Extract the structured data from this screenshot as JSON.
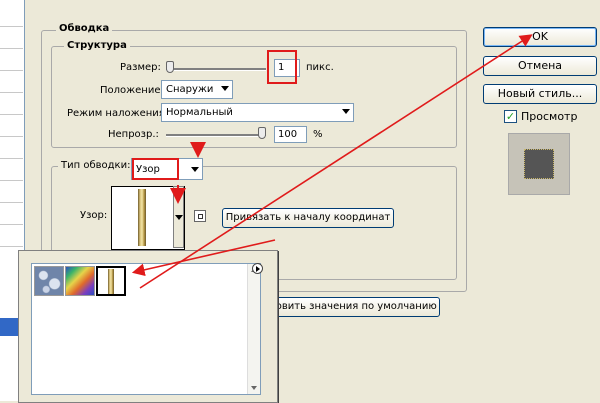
{
  "stroke": {
    "section_title": "Обводка",
    "structure_title": "Структура",
    "size_label": "Размер:",
    "size_value": "1",
    "size_unit": "пикс.",
    "position_label": "Положение:",
    "position_value": "Снаружи",
    "blend_label": "Режим наложения:",
    "blend_value": "Нормальный",
    "opacity_label": "Непрозр.:",
    "opacity_value": "100",
    "opacity_unit": "%",
    "opacity_level": 1.0,
    "stroke_type_label": "Тип обводки:",
    "stroke_type_value": "Узор",
    "pattern_label": "Узор:",
    "snap_button": "Привязать к началу координат",
    "reset_button": "новить значения по умолчанию"
  },
  "buttons": {
    "ok": "OK",
    "cancel": "Отмена",
    "new_style": "Новый стиль...",
    "preview_label": "Просмотр",
    "preview_checked": true
  },
  "colors": {
    "annotation_red": "#e01b1b",
    "selection_blue": "#3168c6",
    "preview_swatch": "#555555"
  },
  "picker": {
    "swatches": [
      "bubbles-pattern",
      "rainbow-pattern",
      "gold-bar-pattern"
    ],
    "selected_index": 2
  }
}
